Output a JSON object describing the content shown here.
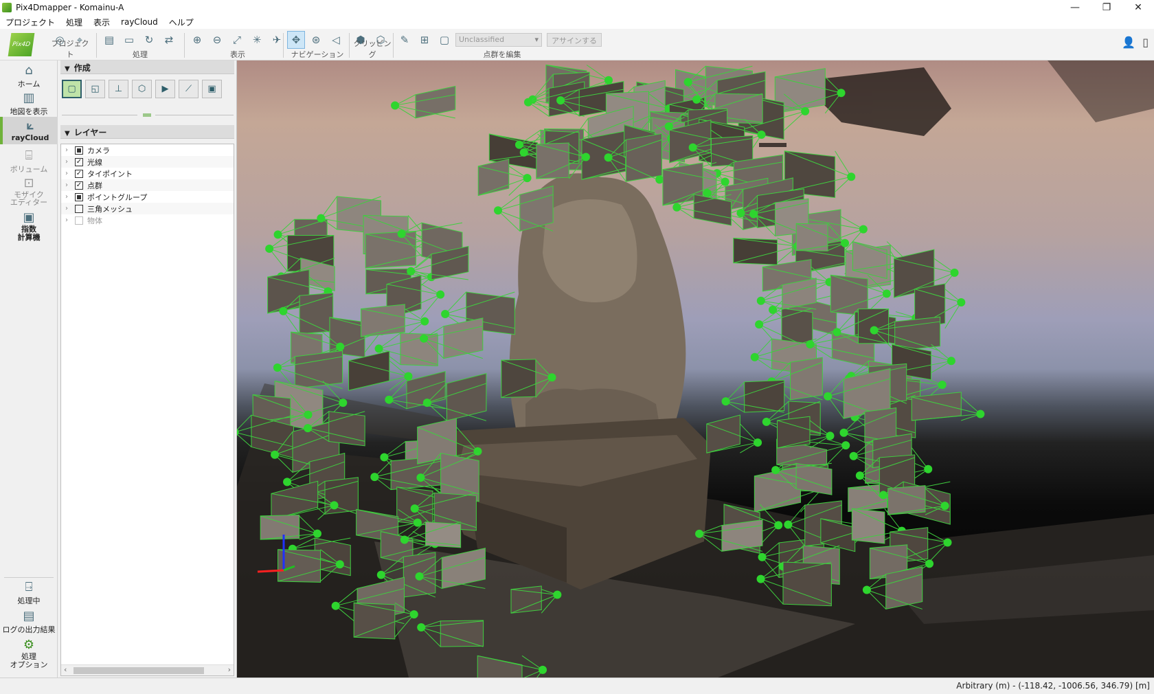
{
  "window": {
    "title": "Pix4Dmapper - Komainu-A",
    "minimize": "—",
    "restore": "❐",
    "close": "✕"
  },
  "menu": [
    "プロジェクト",
    "処理",
    "表示",
    "rayCloud",
    "ヘルプ"
  ],
  "logo_text": "Pix4D",
  "toolbar": {
    "groups": [
      {
        "label": "プロジェクト",
        "icons": [
          "new-project-icon",
          "open-project-icon"
        ]
      },
      {
        "label": "処理",
        "icons": [
          "process-icon",
          "open-folder-icon",
          "reprocess-icon",
          "sync-icon"
        ]
      },
      {
        "label": "表示",
        "icons": [
          "zoom-in-icon",
          "zoom-out-icon",
          "fit-view-icon",
          "collapse-icon",
          "fly-icon"
        ]
      },
      {
        "label": "ナビゲーション",
        "icons": [
          "orbit-icon",
          "trackball-icon",
          "fly-mode-icon"
        ]
      },
      {
        "label": "クリッピング",
        "icons": [
          "clip-box-icon",
          "clip-edit-icon"
        ]
      },
      {
        "label": "点群を編集",
        "icons": [
          "brush-icon",
          "add-point-icon",
          "select-icon"
        ]
      }
    ],
    "class_select": "Unclassified",
    "assign_button": "アサインする"
  },
  "leftnav": {
    "items": [
      {
        "label": "ホーム",
        "icon": "home-icon"
      },
      {
        "label": "地図を表示",
        "icon": "map-icon"
      },
      {
        "label": "rayCloud",
        "icon": "raycloud-icon"
      },
      {
        "label": "ボリューム",
        "icon": "volume-icon"
      },
      {
        "label": "モザイク\nエディター",
        "label1": "モザイク",
        "label2": "エディター",
        "icon": "mosaic-icon"
      },
      {
        "label": "指数\n計算機",
        "label1": "指数",
        "label2": "計算機",
        "icon": "index-calculator-icon"
      }
    ],
    "bottom": [
      {
        "label": "処理中",
        "icon": "processing-icon"
      },
      {
        "label": "ログの出力結果",
        "icon": "log-icon"
      },
      {
        "label1": "処理",
        "label2": "オプション",
        "icon": "gear-icon"
      }
    ]
  },
  "panel": {
    "create_header": "作成",
    "layers_header": "レイヤー",
    "layers": [
      {
        "label": "カメラ",
        "state": "partial"
      },
      {
        "label": "光線",
        "state": "checked"
      },
      {
        "label": "タイポイント",
        "state": "checked"
      },
      {
        "label": "点群",
        "state": "checked"
      },
      {
        "label": "ポイントグループ",
        "state": "partial"
      },
      {
        "label": "三角メッシュ",
        "state": "unchecked"
      },
      {
        "label": "物体",
        "state": "disabled"
      }
    ]
  },
  "status": {
    "coords": "Arbitrary (m) - (-118.42, -1006.56, 346.79) [m]"
  },
  "colors": {
    "camera_green": "#2ed52e",
    "frame_green": "#3fcf3f",
    "accent": "#6fb23a"
  }
}
